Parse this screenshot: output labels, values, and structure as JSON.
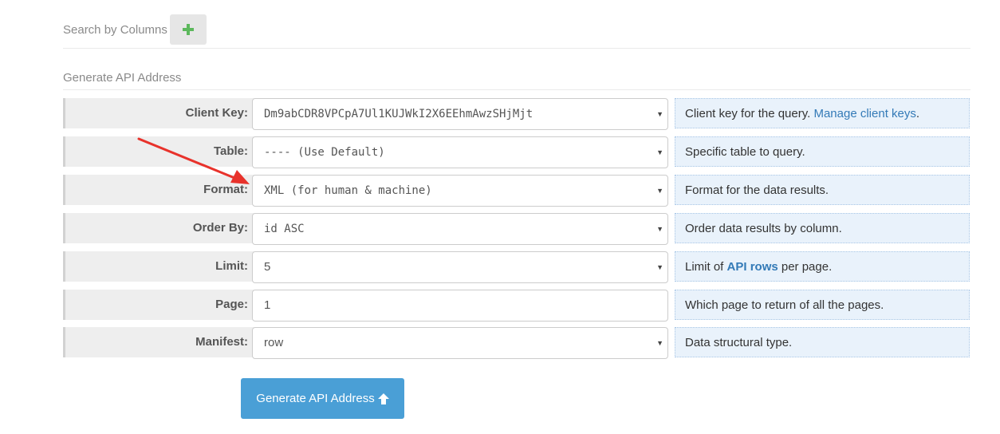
{
  "search": {
    "label": "Search by Columns",
    "add_icon": "plus-icon"
  },
  "section": {
    "title": "Generate API Address"
  },
  "colors": {
    "accent": "#4a9fd6",
    "link": "#337ab7",
    "help_bg": "#e9f2fb",
    "annotation": "#e8322b"
  },
  "rows": {
    "client_key": {
      "label": "Client Key:",
      "value": "Dm9abCDR8VPCpA7Ul1KUJWkI2X6EEhmAwzSHjMjt",
      "help": "Client key for the query. ",
      "help_link": "Manage client keys",
      "help_after": "."
    },
    "table": {
      "label": "Table:",
      "value": "---- (Use Default)",
      "help": "Specific table to query."
    },
    "format": {
      "label": "Format:",
      "value": "XML (for human & machine)",
      "help": "Format for the data results."
    },
    "order_by": {
      "label": "Order By:",
      "value": "id ASC",
      "help": "Order data results by column."
    },
    "limit": {
      "label": "Limit:",
      "value": "5",
      "help_before": "Limit of ",
      "help_link": "API rows",
      "help_after": " per page."
    },
    "page": {
      "label": "Page:",
      "value": "1",
      "help": "Which page to return of all the pages."
    },
    "manifest": {
      "label": "Manifest:",
      "value": "row",
      "help": "Data structural type."
    }
  },
  "generate": {
    "label": "Generate API Address",
    "icon": "arrow-up-icon"
  }
}
